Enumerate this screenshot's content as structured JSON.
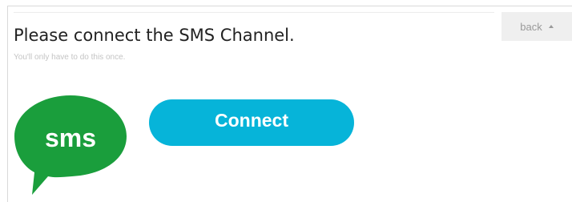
{
  "header": {
    "title": "Please connect the SMS Channel.",
    "subtitle": "You'll only have to do this once.",
    "back_label": "back",
    "back_icon": "caret-up-icon"
  },
  "channel": {
    "logo_text": "sms",
    "logo_color": "#1a9e3c",
    "logo_icon": "sms-speech-bubble-icon"
  },
  "actions": {
    "connect_label": "Connect",
    "connect_color": "#06b4d9"
  }
}
